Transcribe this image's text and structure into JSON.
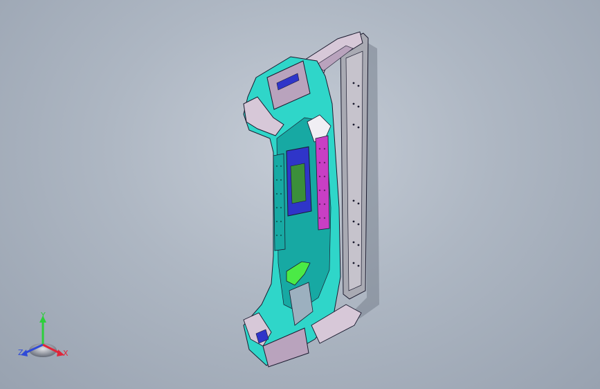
{
  "viewport": {
    "background_top": "#c5ccd6",
    "background_bottom": "#98a2b0"
  },
  "model": {
    "colors": {
      "outline": "#1a1a2e",
      "body_teal": "#2fd6c9",
      "body_dark_teal": "#17a9a3",
      "shell_lavender": "#d7c8d8",
      "shell_mauve": "#b9a3bd",
      "rail_gray": "#a9aab3",
      "accent_blue": "#2f35c9",
      "accent_magenta": "#c83fc4",
      "accent_green": "#4bea46",
      "pcb_green": "#3b8f3a",
      "shadow": "#6d7683"
    }
  },
  "triad": {
    "y_label": "Y",
    "z_label": "Z",
    "x_label": "X",
    "y_color": "#2ccf3a",
    "z_color": "#2f4ad8",
    "x_color": "#e0263a"
  }
}
